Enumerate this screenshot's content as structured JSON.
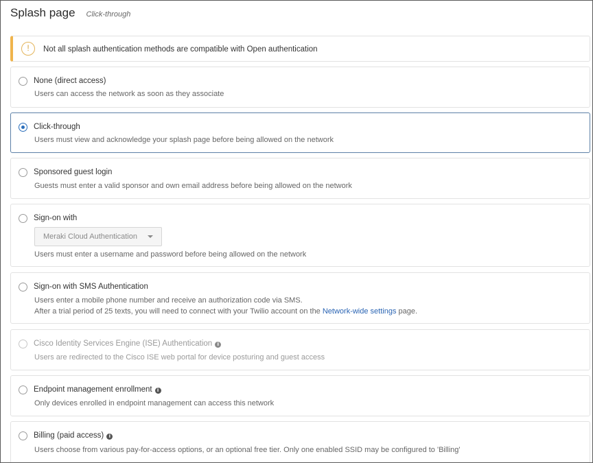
{
  "header": {
    "title": "Splash page",
    "subtitle": "Click-through"
  },
  "warning": {
    "icon": "exclamation-circle-icon",
    "text": "Not all splash authentication methods are compatible with Open authentication"
  },
  "options": [
    {
      "label": "None (direct access)",
      "description": "Users can access the network as soon as they associate",
      "selected": false
    },
    {
      "label": "Click-through",
      "description": "Users must view and acknowledge your splash page before being allowed on the network",
      "selected": true
    },
    {
      "label": "Sponsored guest login",
      "description": "Guests must enter a valid sponsor and own email address before being allowed on the network",
      "selected": false
    },
    {
      "label": "Sign-on with",
      "dropdown_value": "Meraki Cloud Authentication",
      "description": "Users must enter a username and password before being allowed on the network",
      "selected": false
    },
    {
      "label": "Sign-on with SMS Authentication",
      "description": "Users enter a mobile phone number and receive an authorization code via SMS.",
      "description2_prefix": "After a trial period of 25 texts, you will need to connect with your Twilio account on the ",
      "description2_link": "Network-wide settings",
      "description2_suffix": " page.",
      "selected": false
    },
    {
      "label": "Cisco Identity Services Engine (ISE) Authentication",
      "description": "Users are redirected to the Cisco ISE web portal for device posturing and guest access",
      "selected": false,
      "disabled": true
    },
    {
      "label": "Endpoint management enrollment",
      "description": "Only devices enrolled in endpoint management can access this network",
      "selected": false
    },
    {
      "label": "Billing (paid access)",
      "description": "Users choose from various pay-for-access options, or an optional free tier. Only one enabled SSID may be configured to 'Billing'",
      "selected": false
    }
  ],
  "colors": {
    "accent": "#2a6ebb",
    "warning": "#f0b44c",
    "link": "#2a64b3"
  }
}
